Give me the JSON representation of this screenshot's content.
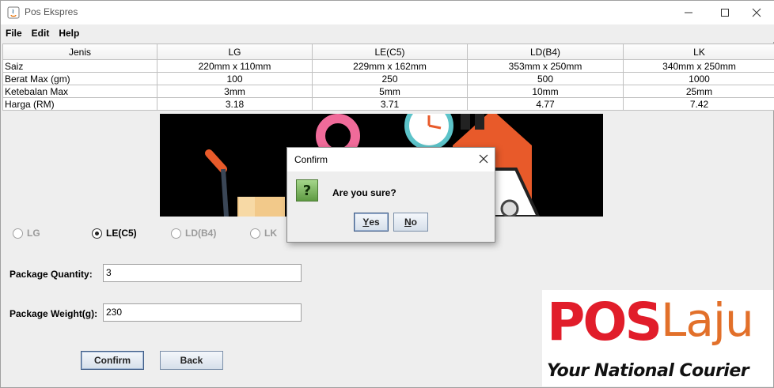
{
  "window": {
    "title": "Pos Ekspres"
  },
  "menu": {
    "items": [
      "File",
      "Edit",
      "Help"
    ]
  },
  "table": {
    "headers": [
      "Jenis",
      "LG",
      "LE(C5)",
      "LD(B4)",
      "LK"
    ],
    "rows": [
      [
        "Saiz",
        "220mm x 110mm",
        "229mm x 162mm",
        "353mm x 250mm",
        "340mm x 250mm"
      ],
      [
        "Berat Max (gm)",
        "100",
        "250",
        "500",
        "1000"
      ],
      [
        "Ketebalan Max",
        "3mm",
        "5mm",
        "10mm",
        "25mm"
      ],
      [
        "Harga (RM)",
        "3.18",
        "3.71",
        "4.77",
        "7.42"
      ]
    ]
  },
  "radios": [
    {
      "label": "LG",
      "checked": false,
      "enabled": false
    },
    {
      "label": "LE(C5)",
      "checked": true,
      "enabled": true
    },
    {
      "label": "LD(B4)",
      "checked": false,
      "enabled": false
    },
    {
      "label": "LK",
      "checked": false,
      "enabled": false
    }
  ],
  "form": {
    "quantity_label": "Package Quantity:",
    "quantity_value": "3",
    "weight_label": "Package Weight(g):",
    "weight_value": "230"
  },
  "buttons": {
    "confirm": "Confirm",
    "back": "Back"
  },
  "logo": {
    "pos": "POS",
    "laju": "Laju",
    "tagline": "Your National Courier"
  },
  "dialog": {
    "title": "Confirm",
    "message": "Are you sure?",
    "yes_rest": "es",
    "yes_mnemonic": "Y",
    "no_rest": "o",
    "no_mnemonic": "N"
  },
  "colors": {
    "pos_red": "#e11d2a",
    "laju_orange": "#e2702a",
    "question_green": "#5e9a42"
  }
}
